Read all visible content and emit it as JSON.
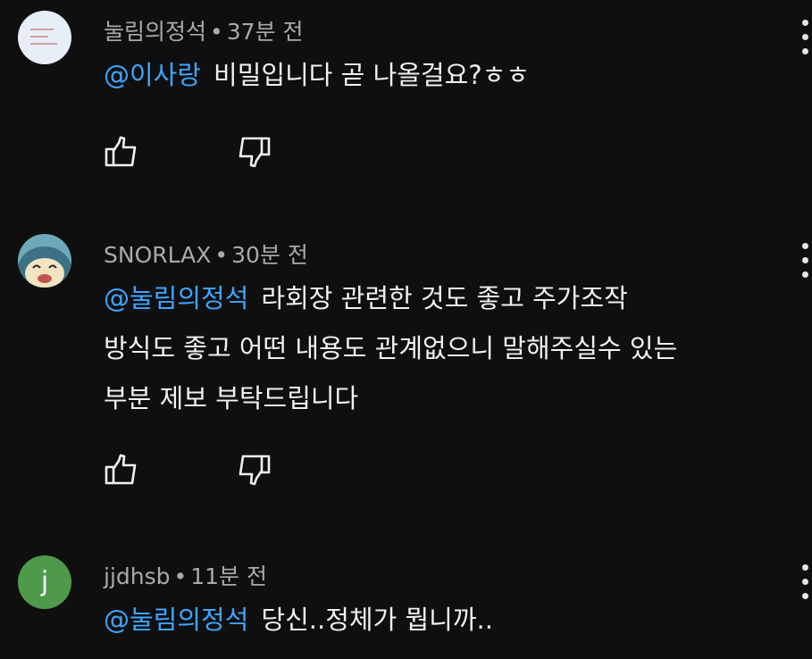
{
  "comments": [
    {
      "author": "눌림의정석",
      "separator": "•",
      "time": "37분 전",
      "mention": "@이사랑",
      "lines": [
        "비밀입니다 곧 나올걸요?ㅎㅎ"
      ],
      "avatar_icon": "document-thumbnail-icon"
    },
    {
      "author": "SNORLAX",
      "separator": "•",
      "time": "30분 전",
      "mention": "@눌림의정석",
      "lines": [
        "라회장 관련한 것도 좋고 주가조작",
        "방식도 좋고 어떤 내용도 관계없으니 말해주실수 있는",
        "부분 제보 부탁드립니다"
      ],
      "avatar_icon": "snorlax-avatar-icon"
    },
    {
      "author": "jjdhsb",
      "separator": "•",
      "time": "11분 전",
      "mention": "@눌림의정석",
      "lines": [
        "당신..정체가 뭡니까.."
      ],
      "avatar_letter": "j",
      "avatar_color": "#4f9a4a"
    }
  ],
  "icons": {
    "like": "thumbs-up-icon",
    "dislike": "thumbs-down-icon",
    "more": "more-vertical-icon"
  },
  "colors": {
    "background": "#0f0f0f",
    "mention": "#3ea6ff",
    "meta": "#aaaaaa",
    "text": "#f1f1f1"
  }
}
